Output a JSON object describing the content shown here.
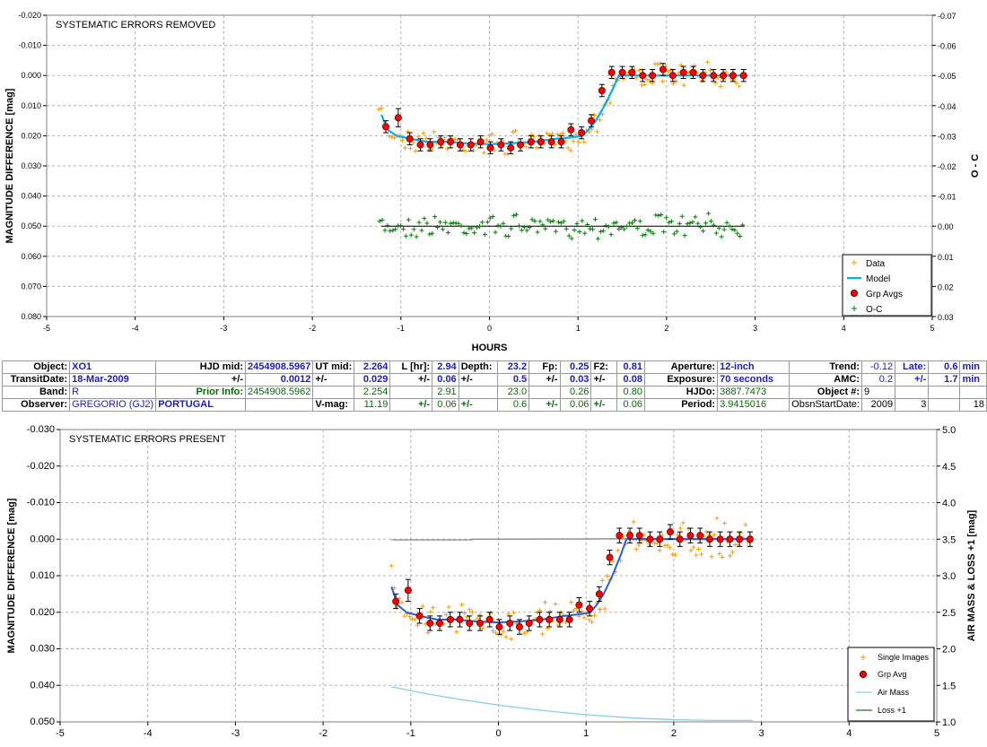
{
  "colors": {
    "data": "#ff9900",
    "model": "#00b0f0",
    "grp": "#ff0000",
    "oc": "#008000",
    "model2": "#1f5fe0",
    "airmass": "#87ceeb",
    "loss": "#808080",
    "blue": "#1a1acc",
    "green": "#007000"
  },
  "chart_data": [
    {
      "type": "scatter",
      "title": "SYSTEMATIC ERRORS REMOVED",
      "xlabel": "HOURS",
      "ylabel": "MAGNITUDE DIFFERENCE [mag]",
      "y2label": "O - C",
      "xlim": [
        -5,
        5
      ],
      "ylim": [
        -0.02,
        0.08
      ],
      "y2lim": [
        -0.07,
        0.03
      ],
      "x_ticks": [
        "-5",
        "-4",
        "-3",
        "-2",
        "-1",
        "0",
        "1",
        "2",
        "3",
        "4",
        "5"
      ],
      "y_ticks": [
        "-0.020",
        "-0.010",
        "0.000",
        "0.010",
        "0.020",
        "0.030",
        "0.040",
        "0.050",
        "0.060",
        "0.070",
        "0.080"
      ],
      "y2_ticks": [
        "-0.07",
        "-0.06",
        "-0.05",
        "-0.04",
        "-0.03",
        "-0.02",
        "-0.01",
        "0.00",
        "0.01",
        "0.02",
        "0.03"
      ],
      "grid": true,
      "legend": [
        "Data",
        "Model",
        "Grp Avgs",
        "O-C"
      ],
      "legend_position": "bottom-right",
      "grp_avgs": {
        "x": [
          -1.17,
          -1.03,
          -0.9,
          -0.78,
          -0.67,
          -0.55,
          -0.44,
          -0.33,
          -0.21,
          -0.1,
          0.01,
          0.13,
          0.24,
          0.35,
          0.47,
          0.58,
          0.7,
          0.81,
          0.92,
          1.04,
          1.15,
          1.27,
          1.38,
          1.5,
          1.61,
          1.73,
          1.84,
          1.96,
          2.07,
          2.19,
          2.3,
          2.41,
          2.53,
          2.64,
          2.75,
          2.87
        ],
        "y": [
          0.017,
          0.014,
          0.021,
          0.023,
          0.023,
          0.022,
          0.022,
          0.023,
          0.023,
          0.022,
          0.024,
          0.023,
          0.024,
          0.023,
          0.022,
          0.022,
          0.022,
          0.022,
          0.018,
          0.019,
          0.015,
          0.005,
          -0.001,
          -0.001,
          -0.001,
          0.0,
          0.0,
          -0.002,
          0.0,
          -0.001,
          -0.001,
          0.0,
          0.0,
          0.0,
          0.0,
          0.0
        ],
        "err": [
          0.002,
          0.003,
          0.002,
          0.002,
          0.002,
          0.002,
          0.002,
          0.002,
          0.002,
          0.002,
          0.002,
          0.002,
          0.002,
          0.002,
          0.002,
          0.002,
          0.002,
          0.002,
          0.002,
          0.002,
          0.002,
          0.002,
          0.002,
          0.002,
          0.002,
          0.002,
          0.002,
          0.002,
          0.002,
          0.002,
          0.002,
          0.002,
          0.002,
          0.002,
          0.002,
          0.002
        ]
      },
      "model": {
        "x": [
          -1.22,
          -1.15,
          -1.05,
          -0.9,
          -0.7,
          -0.5,
          -0.25,
          0.0,
          0.25,
          0.5,
          0.75,
          0.95,
          1.05,
          1.12,
          1.2,
          1.3,
          1.4,
          1.46,
          1.5,
          2.0,
          2.9
        ],
        "y": [
          0.013,
          0.018,
          0.02,
          0.021,
          0.022,
          0.022,
          0.0225,
          0.0228,
          0.0225,
          0.022,
          0.021,
          0.0205,
          0.02,
          0.018,
          0.015,
          0.01,
          0.004,
          0.0,
          0.0,
          0.0,
          0.0
        ]
      }
    },
    {
      "type": "scatter",
      "title": "SYSTEMATIC ERRORS PRESENT",
      "ylabel": "MAGNITUDE DIFFERENCE [mag]",
      "y2label": "AIR MASS & LOSS +1 [mag]",
      "xlim": [
        -5,
        5
      ],
      "ylim": [
        -0.03,
        0.05
      ],
      "y2lim": [
        1.0,
        5.0
      ],
      "x_ticks": [
        "-5",
        "-4",
        "-3",
        "-2",
        "-1",
        "0",
        "1",
        "2",
        "3",
        "4",
        "5"
      ],
      "y_ticks": [
        "-0.030",
        "-0.020",
        "-0.010",
        "0.000",
        "0.010",
        "0.020",
        "0.030",
        "0.040",
        "0.050"
      ],
      "y2_ticks": [
        "5.0",
        "4.5",
        "4.0",
        "3.5",
        "3.0",
        "2.5",
        "2.0",
        "1.5",
        "1.0"
      ],
      "grid": true,
      "legend": [
        "Single Images",
        "Grp Avg",
        "Air Mass",
        "Loss +1"
      ],
      "legend_position": "bottom-right",
      "airmass": {
        "x": [
          -1.22,
          -0.8,
          -0.4,
          0,
          0.4,
          0.8,
          1.2,
          1.6,
          2.0,
          2.4,
          2.9
        ],
        "y": [
          1.48,
          1.38,
          1.3,
          1.23,
          1.17,
          1.12,
          1.08,
          1.05,
          1.03,
          1.02,
          1.02
        ]
      },
      "loss_plus_1": {
        "x": [
          -1.22,
          -0.3,
          -0.3,
          2.9
        ],
        "y": [
          3.49,
          3.49,
          3.5,
          3.51
        ]
      }
    }
  ],
  "table": {
    "rows": [
      [
        {
          "t": "Object:",
          "c": "r b"
        },
        {
          "t": "XO1",
          "c": "b blue"
        },
        {
          "t": "HJD mid:",
          "c": "r b"
        },
        {
          "t": "2454908.5967",
          "c": "r b blue"
        },
        {
          "t": "UT mid:",
          "c": "b"
        },
        {
          "t": "2.264",
          "c": "r b blue"
        },
        {
          "t": "L [hr]:",
          "c": "r b"
        },
        {
          "t": "2.94",
          "c": "r b blue"
        },
        {
          "t": "Depth:",
          "c": "b"
        },
        {
          "t": "23.2",
          "c": "r b blue"
        },
        {
          "t": "Fp:",
          "c": "r b"
        },
        {
          "t": "0.25",
          "c": "r b blue"
        },
        {
          "t": "F2:",
          "c": "b"
        },
        {
          "t": "0.81",
          "c": "r b blue"
        },
        {
          "t": "Aperture:",
          "c": "r b"
        },
        {
          "t": "12-inch",
          "c": "b blue"
        },
        {
          "t": "Trend:",
          "c": "r b"
        },
        {
          "t": "-0.12",
          "c": "r blue"
        },
        {
          "t": "Late:",
          "c": "r b blue"
        },
        {
          "t": "0.6",
          "c": "r b blue"
        },
        {
          "t": "min",
          "c": "b blue"
        }
      ],
      [
        {
          "t": "TransitDate:",
          "c": "r b"
        },
        {
          "t": "18-Mar-2009",
          "c": "b blue"
        },
        {
          "t": "+/-",
          "c": "r b"
        },
        {
          "t": "0.0012",
          "c": "r b blue"
        },
        {
          "t": "+/-",
          "c": "b"
        },
        {
          "t": "0.029",
          "c": "r b blue"
        },
        {
          "t": "+/-",
          "c": "r b"
        },
        {
          "t": "0.06",
          "c": "r b blue"
        },
        {
          "t": "+/-",
          "c": "b"
        },
        {
          "t": "0.5",
          "c": "r b blue"
        },
        {
          "t": "+/-",
          "c": "r b"
        },
        {
          "t": "0.03",
          "c": "r b blue"
        },
        {
          "t": "+/-",
          "c": "b"
        },
        {
          "t": "0.08",
          "c": "r b blue"
        },
        {
          "t": "Exposure:",
          "c": "r b"
        },
        {
          "t": "70 seconds",
          "c": "b blue"
        },
        {
          "t": "AMC:",
          "c": "r b"
        },
        {
          "t": "0.2",
          "c": "r blue"
        },
        {
          "t": "+/-",
          "c": "r b blue"
        },
        {
          "t": "1.7",
          "c": "r b blue"
        },
        {
          "t": "min",
          "c": "b blue"
        }
      ],
      [
        {
          "t": "Band:",
          "c": "r b"
        },
        {
          "t": "R",
          "c": "blue"
        },
        {
          "t": "Prior Info:",
          "c": "r b green"
        },
        {
          "t": "2454908.5962",
          "c": "r green"
        },
        {
          "t": "",
          "c": ""
        },
        {
          "t": "2.254",
          "c": "r green"
        },
        {
          "t": "",
          "c": ""
        },
        {
          "t": "2.91",
          "c": "r green"
        },
        {
          "t": "",
          "c": ""
        },
        {
          "t": "23.0",
          "c": "r green"
        },
        {
          "t": "",
          "c": ""
        },
        {
          "t": "0.26",
          "c": "r green"
        },
        {
          "t": "",
          "c": ""
        },
        {
          "t": "0.80",
          "c": "r green"
        },
        {
          "t": "HJDo:",
          "c": "r b"
        },
        {
          "t": "3887.7473",
          "c": "green"
        },
        {
          "t": "Object #:",
          "c": "r b"
        },
        {
          "t": "9",
          "c": ""
        },
        {
          "t": "",
          "c": ""
        },
        {
          "t": "",
          "c": ""
        },
        {
          "t": "",
          "c": ""
        }
      ],
      [
        {
          "t": "Observer:",
          "c": "r b"
        },
        {
          "t": "GREGORIO (GJ2)",
          "c": "blue"
        },
        {
          "t": "PORTUGAL",
          "c": "b blue"
        },
        {
          "t": "",
          "c": ""
        },
        {
          "t": "V-mag:",
          "c": "b"
        },
        {
          "t": "11.19",
          "c": "r green"
        },
        {
          "t": "+/-",
          "c": "r b green"
        },
        {
          "t": "0.06",
          "c": "r green"
        },
        {
          "t": "+/-",
          "c": "b green"
        },
        {
          "t": "0.6",
          "c": "r green"
        },
        {
          "t": "+/-",
          "c": "r b green"
        },
        {
          "t": "0.06",
          "c": "r green"
        },
        {
          "t": "+/-",
          "c": "b green"
        },
        {
          "t": "0.06",
          "c": "r green"
        },
        {
          "t": "Period:",
          "c": "r b"
        },
        {
          "t": "3.9415016",
          "c": "green"
        },
        {
          "t": "ObsnStartDate:",
          "c": "r"
        },
        {
          "t": "2009",
          "c": "r"
        },
        {
          "t": "3",
          "c": "r"
        },
        {
          "t": "",
          "c": ""
        },
        {
          "t": "18",
          "c": "r"
        }
      ]
    ]
  }
}
